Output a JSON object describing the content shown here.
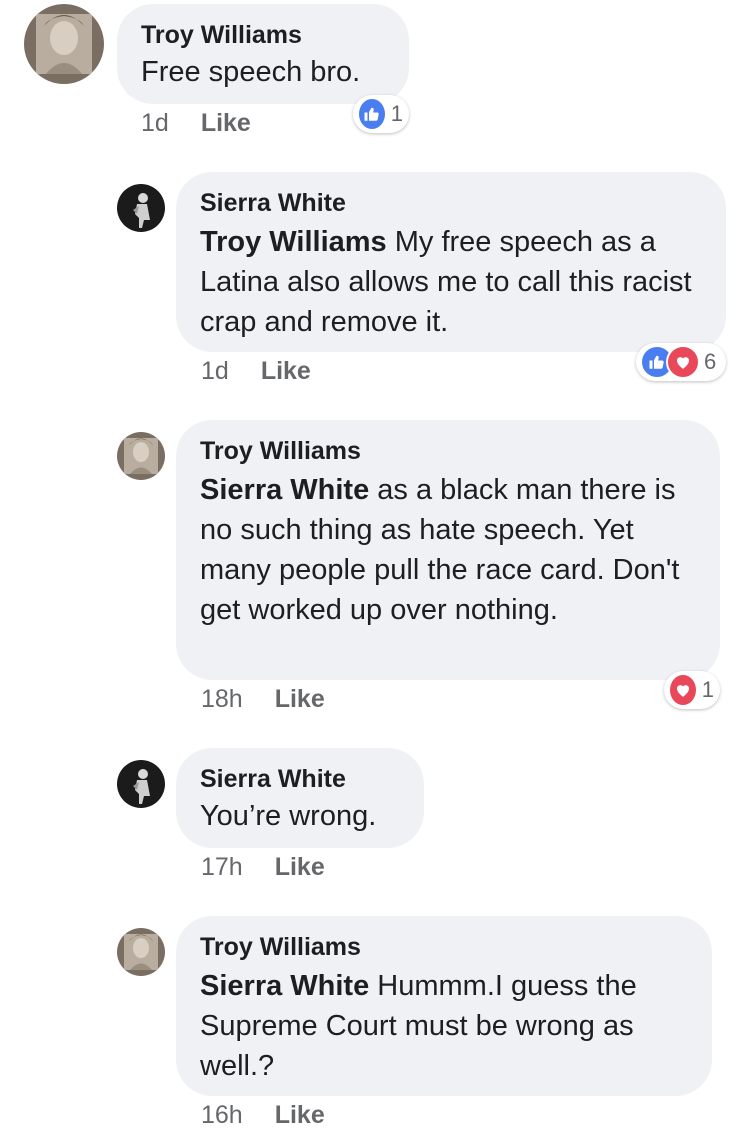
{
  "comments": [
    {
      "author": "Troy Williams",
      "mention": "",
      "text": "Free speech bro.",
      "time": "1d",
      "like_label": "Like",
      "reaction_count": "1"
    },
    {
      "author": "Sierra White",
      "mention": "Troy Williams",
      "text": " My free speech as a Latina also allows me to call this racist crap and remove it.",
      "time": "1d",
      "like_label": "Like",
      "reaction_count": "6"
    },
    {
      "author": "Troy Williams",
      "mention": "Sierra White",
      "text": " as a black man there is no such thing as hate speech. Yet many people pull the race card. Don't get worked up over nothing.",
      "time": "18h",
      "like_label": "Like",
      "reaction_count": "1"
    },
    {
      "author": "Sierra White",
      "mention": "",
      "text": "You’re wrong.",
      "time": "17h",
      "like_label": "Like"
    },
    {
      "author": "Troy Williams",
      "mention": "Sierra White",
      "text": " Hummm.I guess the Supreme Court must be wrong as well.?",
      "time": "16h",
      "like_label": "Like"
    }
  ],
  "colors": {
    "bubble": "#f0f1f4",
    "like_reaction": "#4a7ef0",
    "love_reaction": "#e8485a",
    "meta_text": "#65676b"
  },
  "icons": {
    "like_reaction": "thumbs-up-icon",
    "love_reaction": "heart-icon"
  }
}
